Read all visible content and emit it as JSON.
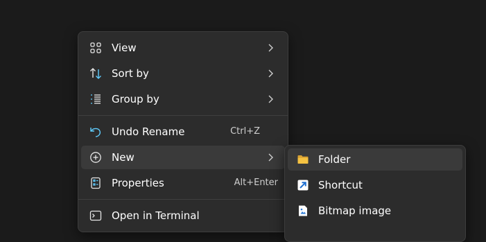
{
  "context_menu": {
    "items": [
      {
        "label": "View",
        "icon": "grid-view-icon",
        "has_submenu": true
      },
      {
        "label": "Sort by",
        "icon": "sort-arrows-icon",
        "has_submenu": true
      },
      {
        "label": "Group by",
        "icon": "group-list-icon",
        "has_submenu": true
      },
      {
        "label": "Undo Rename",
        "icon": "undo-icon",
        "shortcut": "Ctrl+Z"
      },
      {
        "label": "New",
        "icon": "add-circle-icon",
        "has_submenu": true,
        "highlighted": true
      },
      {
        "label": "Properties",
        "icon": "properties-icon",
        "shortcut": "Alt+Enter"
      },
      {
        "label": "Open in Terminal",
        "icon": "terminal-icon"
      }
    ]
  },
  "new_submenu": {
    "items": [
      {
        "label": "Folder",
        "icon": "folder-icon",
        "highlighted": true
      },
      {
        "label": "Shortcut",
        "icon": "shortcut-icon"
      },
      {
        "label": "Bitmap image",
        "icon": "bitmap-image-icon"
      }
    ]
  },
  "colors": {
    "background": "#1b1b1b",
    "menu_background": "#2c2c2c",
    "highlight": "#3a3a3a",
    "icon_accent": "#60cdff",
    "folder": "#f5c242"
  }
}
